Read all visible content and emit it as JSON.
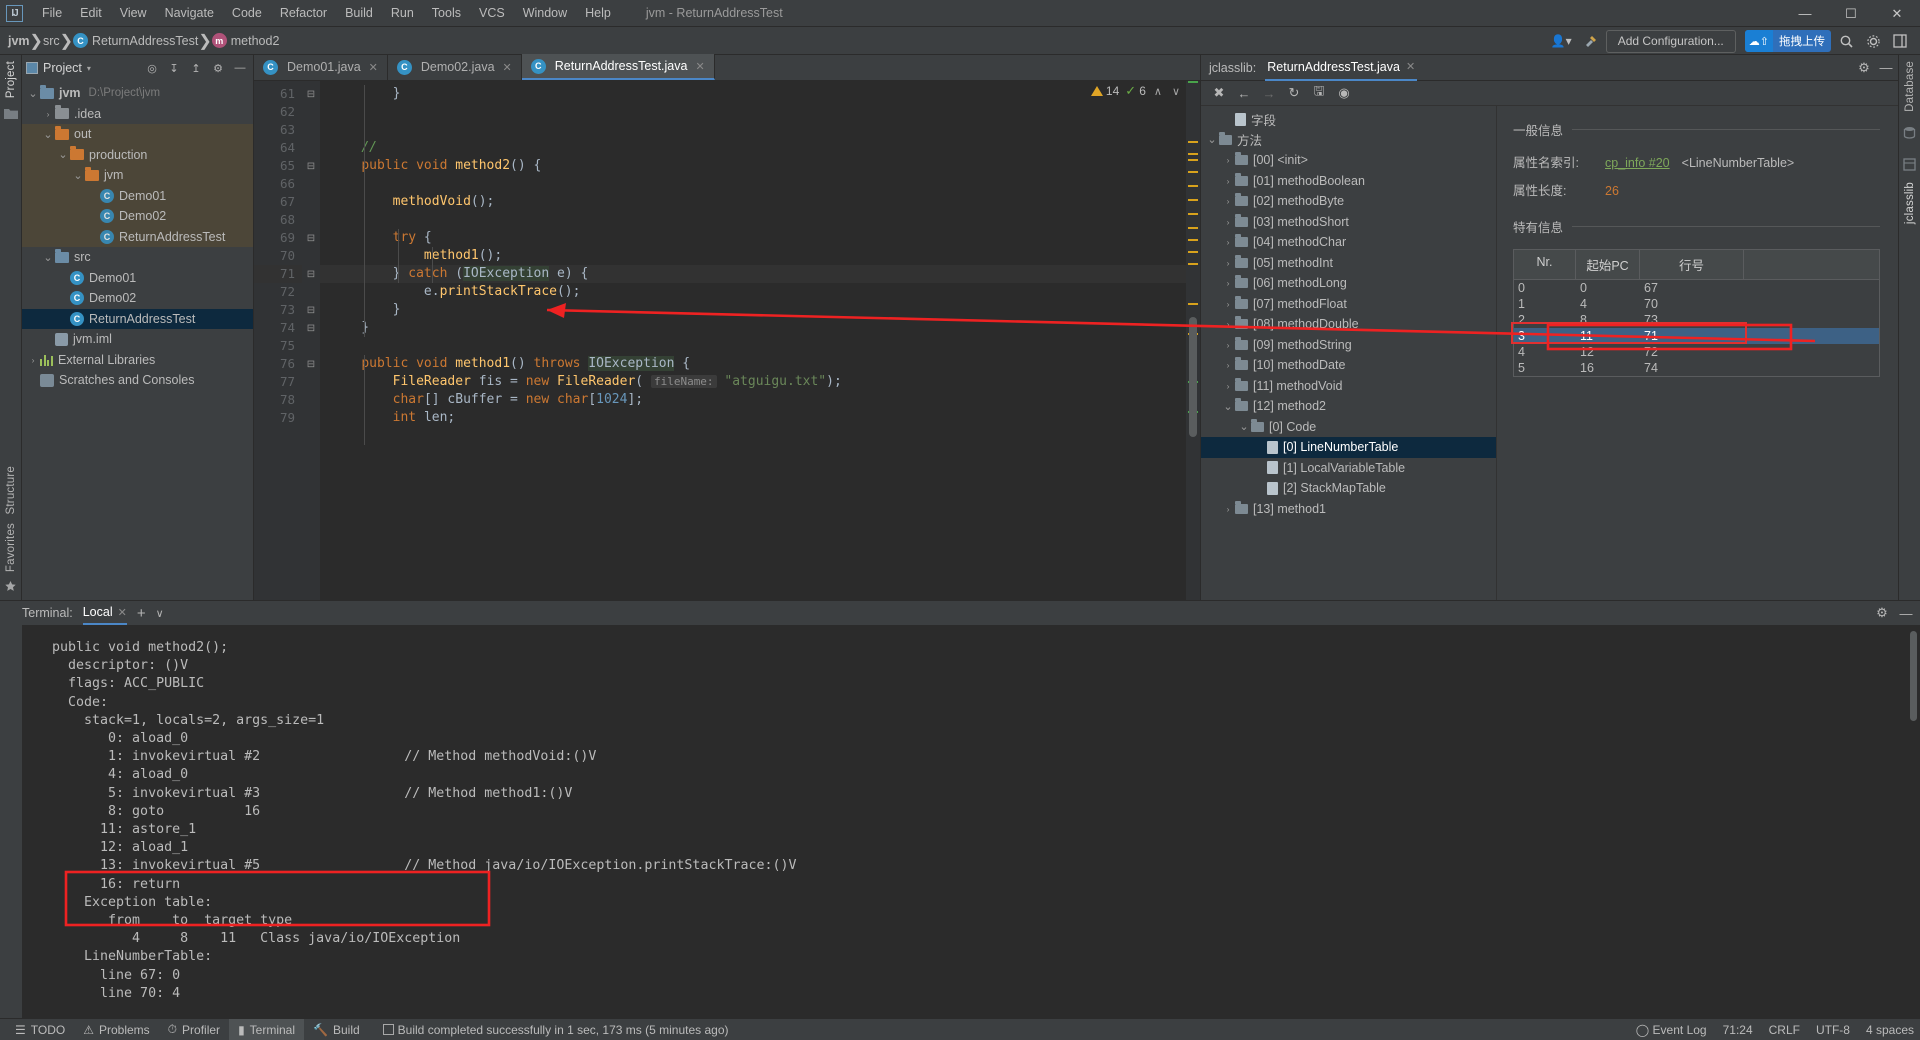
{
  "window": {
    "title": "jvm - ReturnAddressTest",
    "logo": "IJ",
    "controls": {
      "minimize": "—",
      "maximize": "☐",
      "close": "✕"
    }
  },
  "menubar": {
    "items": [
      "File",
      "Edit",
      "View",
      "Navigate",
      "Code",
      "Refactor",
      "Build",
      "Run",
      "Tools",
      "VCS",
      "Window",
      "Help"
    ]
  },
  "breadcrumb": {
    "project": "jvm",
    "src": "src",
    "class": "ReturnAddressTest",
    "method": "method2",
    "class_icon": "C",
    "method_icon": "m",
    "separator": "❯"
  },
  "navbar_right": {
    "profile_icon": "user-icon",
    "hammer_icon": "hammer-icon",
    "add_configuration": "Add Configuration...",
    "upload_badge_icon": "cloud-upload-icon",
    "upload_badge_text": "拖拽上传",
    "search_icon": "search-icon",
    "settings_icon": "gear-icon",
    "layout_icon": "layout-icon"
  },
  "left_strip": {
    "items": [
      "Project"
    ],
    "icon": "folder-icon"
  },
  "left_strip_bottom": {
    "items": [
      "Structure",
      "Favorites"
    ],
    "star_icon": "star-icon"
  },
  "right_strip": {
    "items": [
      "Database",
      "jclasslib"
    ]
  },
  "project_panel": {
    "title": "Project",
    "toolbar_icons": [
      "target-icon",
      "collapse-icon",
      "expand-icon",
      "gear-icon",
      "minimize-icon"
    ],
    "tree": [
      {
        "depth": 0,
        "arrow": "∨",
        "icon": "folder-blue",
        "label": "jvm",
        "sub": "D:\\Project\\jvm",
        "bold": true,
        "state": "normal"
      },
      {
        "depth": 1,
        "arrow": "›",
        "icon": "folder-grey",
        "label": ".idea",
        "sub": "",
        "bold": false,
        "state": "normal"
      },
      {
        "depth": 1,
        "arrow": "∨",
        "icon": "folder-orange",
        "label": "out",
        "sub": "",
        "bold": false,
        "state": "out"
      },
      {
        "depth": 2,
        "arrow": "∨",
        "icon": "folder-orange",
        "label": "production",
        "sub": "",
        "bold": false,
        "state": "out"
      },
      {
        "depth": 3,
        "arrow": "∨",
        "icon": "folder-orange",
        "label": "jvm",
        "sub": "",
        "bold": false,
        "state": "out"
      },
      {
        "depth": 4,
        "arrow": "",
        "icon": "class-compiled",
        "label": "Demo01",
        "sub": "",
        "bold": false,
        "state": "out"
      },
      {
        "depth": 4,
        "arrow": "",
        "icon": "class-compiled",
        "label": "Demo02",
        "sub": "",
        "bold": false,
        "state": "out"
      },
      {
        "depth": 4,
        "arrow": "",
        "icon": "class-compiled",
        "label": "ReturnAddressTest",
        "sub": "",
        "bold": false,
        "state": "out"
      },
      {
        "depth": 1,
        "arrow": "∨",
        "icon": "folder-blue",
        "label": "src",
        "sub": "",
        "bold": false,
        "state": "normal"
      },
      {
        "depth": 2,
        "arrow": "",
        "icon": "class",
        "label": "Demo01",
        "sub": "",
        "bold": false,
        "state": "normal"
      },
      {
        "depth": 2,
        "arrow": "",
        "icon": "class",
        "label": "Demo02",
        "sub": "",
        "bold": false,
        "state": "normal"
      },
      {
        "depth": 2,
        "arrow": "",
        "icon": "class",
        "label": "ReturnAddressTest",
        "sub": "",
        "bold": false,
        "state": "selected"
      },
      {
        "depth": 1,
        "arrow": "",
        "icon": "iml",
        "label": "jvm.iml",
        "sub": "",
        "bold": false,
        "state": "normal"
      },
      {
        "depth": 0,
        "arrow": "›",
        "icon": "library",
        "label": "External Libraries",
        "sub": "",
        "bold": false,
        "state": "normal"
      },
      {
        "depth": 0,
        "arrow": "",
        "icon": "scratches",
        "label": "Scratches and Consoles",
        "sub": "",
        "bold": false,
        "state": "normal"
      }
    ]
  },
  "editor": {
    "tabs": [
      {
        "label": "Demo01.java",
        "active": false,
        "icon": "C"
      },
      {
        "label": "Demo02.java",
        "active": false,
        "icon": "C"
      },
      {
        "label": "ReturnAddressTest.java",
        "active": true,
        "icon": "C"
      }
    ],
    "inspection": {
      "warning_count": "14",
      "ok_count": "6",
      "up": "∧",
      "down": "∨"
    },
    "first_line_number": 61,
    "highlight_line": 71,
    "lines": [
      {
        "n": 61,
        "fold": "⊖",
        "text": "        }"
      },
      {
        "n": 62,
        "fold": "",
        "text": ""
      },
      {
        "n": 63,
        "fold": "",
        "text": ""
      },
      {
        "n": 64,
        "fold": "",
        "text": "    //"
      },
      {
        "n": 65,
        "fold": "⊖",
        "text": "    public void method2() {"
      },
      {
        "n": 66,
        "fold": "",
        "text": ""
      },
      {
        "n": 67,
        "fold": "",
        "text": "        methodVoid();"
      },
      {
        "n": 68,
        "fold": "",
        "text": ""
      },
      {
        "n": 69,
        "fold": "⊖",
        "text": "        try {"
      },
      {
        "n": 70,
        "fold": "",
        "text": "            method1();"
      },
      {
        "n": 71,
        "fold": "⊖",
        "text": "        } catch (IOException e) {"
      },
      {
        "n": 72,
        "fold": "",
        "text": "            e.printStackTrace();"
      },
      {
        "n": 73,
        "fold": "⊖",
        "text": "        }"
      },
      {
        "n": 74,
        "fold": "⊖",
        "text": "    }"
      },
      {
        "n": 75,
        "fold": "",
        "text": ""
      },
      {
        "n": 76,
        "fold": "⊖",
        "text": "    public void method1() throws IOException {"
      },
      {
        "n": 77,
        "fold": "",
        "text": "        FileReader fis = new FileReader( fileName: \"atguigu.txt\");"
      },
      {
        "n": 78,
        "fold": "",
        "text": "        char[] cBuffer = new char[1024];"
      },
      {
        "n": 79,
        "fold": "",
        "text": "        int len;"
      }
    ],
    "param_hint": "fileName:"
  },
  "jclasslib": {
    "label": "jclasslib:",
    "tab": "ReturnAddressTest.java",
    "tab_close": "✕",
    "toolbar_icons": [
      "close-icon",
      "back-icon",
      "forward-icon",
      "refresh-icon",
      "save-icon",
      "browse-icon"
    ],
    "tree": [
      {
        "depth": 1,
        "arrow": "",
        "icon": "file",
        "label": "字段",
        "selected": false
      },
      {
        "depth": 0,
        "arrow": "∨",
        "icon": "folder",
        "label": "方法",
        "selected": false
      },
      {
        "depth": 1,
        "arrow": "›",
        "icon": "folder",
        "label": "[00] <init>",
        "selected": false
      },
      {
        "depth": 1,
        "arrow": "›",
        "icon": "folder",
        "label": "[01] methodBoolean",
        "selected": false
      },
      {
        "depth": 1,
        "arrow": "›",
        "icon": "folder",
        "label": "[02] methodByte",
        "selected": false
      },
      {
        "depth": 1,
        "arrow": "›",
        "icon": "folder",
        "label": "[03] methodShort",
        "selected": false
      },
      {
        "depth": 1,
        "arrow": "›",
        "icon": "folder",
        "label": "[04] methodChar",
        "selected": false
      },
      {
        "depth": 1,
        "arrow": "›",
        "icon": "folder",
        "label": "[05] methodInt",
        "selected": false
      },
      {
        "depth": 1,
        "arrow": "›",
        "icon": "folder",
        "label": "[06] methodLong",
        "selected": false
      },
      {
        "depth": 1,
        "arrow": "›",
        "icon": "folder",
        "label": "[07] methodFloat",
        "selected": false
      },
      {
        "depth": 1,
        "arrow": "›",
        "icon": "folder",
        "label": "[08] methodDouble",
        "selected": false
      },
      {
        "depth": 1,
        "arrow": "›",
        "icon": "folder",
        "label": "[09] methodString",
        "selected": false
      },
      {
        "depth": 1,
        "arrow": "›",
        "icon": "folder",
        "label": "[10] methodDate",
        "selected": false
      },
      {
        "depth": 1,
        "arrow": "›",
        "icon": "folder",
        "label": "[11] methodVoid",
        "selected": false
      },
      {
        "depth": 1,
        "arrow": "∨",
        "icon": "folder",
        "label": "[12] method2",
        "selected": false
      },
      {
        "depth": 2,
        "arrow": "∨",
        "icon": "folder",
        "label": "[0] Code",
        "selected": false
      },
      {
        "depth": 3,
        "arrow": "",
        "icon": "file",
        "label": "[0] LineNumberTable",
        "selected": true
      },
      {
        "depth": 3,
        "arrow": "",
        "icon": "file",
        "label": "[1] LocalVariableTable",
        "selected": false
      },
      {
        "depth": 3,
        "arrow": "",
        "icon": "file",
        "label": "[2] StackMapTable",
        "selected": false
      },
      {
        "depth": 1,
        "arrow": "›",
        "icon": "folder",
        "label": "[13] method1",
        "selected": false
      }
    ],
    "detail": {
      "general_section": "一般信息",
      "attr_name_label": "属性名索引:",
      "attr_name_link": "cp_info #20",
      "attr_name_value": "<LineNumberTable>",
      "attr_len_label": "属性长度:",
      "attr_len_value": "26",
      "specific_section": "特有信息",
      "table": {
        "headers": [
          "Nr.",
          "起始PC",
          "行号"
        ],
        "rows": [
          {
            "nr": "0",
            "start_pc": "0",
            "line": "67",
            "selected": false
          },
          {
            "nr": "1",
            "start_pc": "4",
            "line": "70",
            "selected": false
          },
          {
            "nr": "2",
            "start_pc": "8",
            "line": "73",
            "selected": false
          },
          {
            "nr": "3",
            "start_pc": "11",
            "line": "71",
            "selected": true
          },
          {
            "nr": "4",
            "start_pc": "12",
            "line": "72",
            "selected": false
          },
          {
            "nr": "5",
            "start_pc": "16",
            "line": "74",
            "selected": false
          }
        ]
      }
    }
  },
  "terminal": {
    "label": "Terminal:",
    "tab": "Local",
    "tab_close": "✕",
    "add": "+",
    "dropdown": "∨",
    "settings_icon": "gear-icon",
    "minimize_icon": "minimize-icon",
    "output": "public void method2();\n  descriptor: ()V\n  flags: ACC_PUBLIC\n  Code:\n    stack=1, locals=2, args_size=1\n       0: aload_0\n       1: invokevirtual #2                  // Method methodVoid:()V\n       4: aload_0\n       5: invokevirtual #3                  // Method method1:()V\n       8: goto          16\n      11: astore_1\n      12: aload_1\n      13: invokevirtual #5                  // Method java/io/IOException.printStackTrace:()V\n      16: return\n    Exception table:\n       from    to  target type\n          4     8    11   Class java/io/IOException\n    LineNumberTable:\n      line 67: 0\n      line 70: 4"
  },
  "statusbar": {
    "tools": [
      {
        "icon": "list-icon",
        "label": "TODO"
      },
      {
        "icon": "problems-icon",
        "label": "Problems"
      },
      {
        "icon": "profiler-icon",
        "label": "Profiler"
      },
      {
        "icon": "terminal-icon",
        "label": "Terminal",
        "active": true
      },
      {
        "icon": "build-icon",
        "label": "Build"
      }
    ],
    "message": "Build completed successfully in 1 sec, 173 ms (5 minutes ago)",
    "event_log": "Event Log",
    "caret": "71:24",
    "line_sep": "CRLF",
    "encoding": "UTF-8",
    "indent": "4 spaces"
  },
  "annotation": {
    "arrow_color": "#ee2222",
    "highlight_boxes": [
      "linenumbertable-row-3",
      "exception-table"
    ]
  }
}
